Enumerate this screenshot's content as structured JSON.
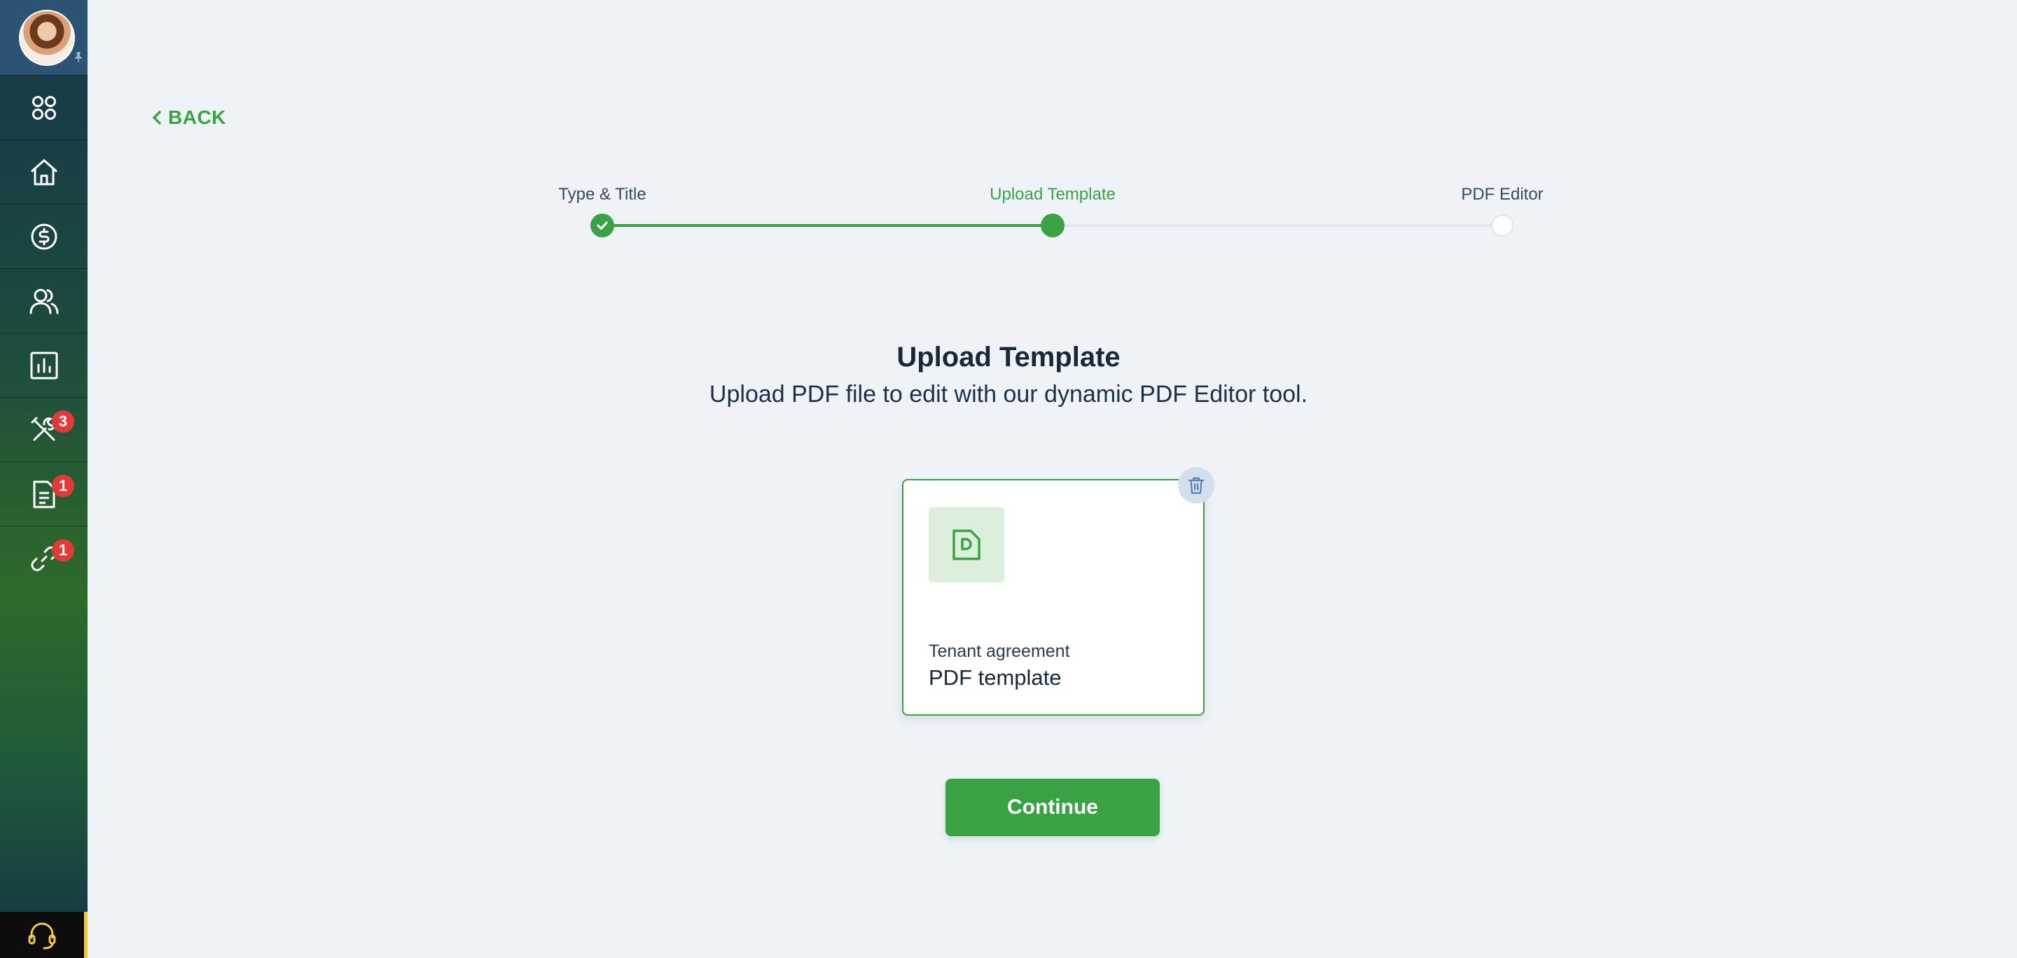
{
  "sidebar": {
    "items": [
      {
        "icon": "apps-grid-icon"
      },
      {
        "icon": "home-icon"
      },
      {
        "icon": "dollar-icon"
      },
      {
        "icon": "users-icon"
      },
      {
        "icon": "bar-chart-icon"
      },
      {
        "icon": "tools-icon",
        "badge": "3"
      },
      {
        "icon": "document-icon",
        "badge": "1"
      },
      {
        "icon": "link-icon",
        "badge": "1"
      }
    ],
    "support_icon": "headset-icon"
  },
  "back": {
    "label": "BACK"
  },
  "stepper": {
    "steps": [
      {
        "label": "Type & Title",
        "state": "done"
      },
      {
        "label": "Upload Template",
        "state": "current"
      },
      {
        "label": "PDF Editor",
        "state": "todo"
      }
    ]
  },
  "main": {
    "title": "Upload Template",
    "subtitle": "Upload PDF file to edit with our dynamic PDF Editor tool."
  },
  "file_card": {
    "category": "Tenant agreement",
    "name": "PDF template",
    "icon": "pdf-file-icon",
    "delete_icon": "trash-icon"
  },
  "actions": {
    "continue_label": "Continue"
  },
  "colors": {
    "accent": "#3aa244",
    "badge": "#e03a3a",
    "background": "#eff3f8"
  }
}
